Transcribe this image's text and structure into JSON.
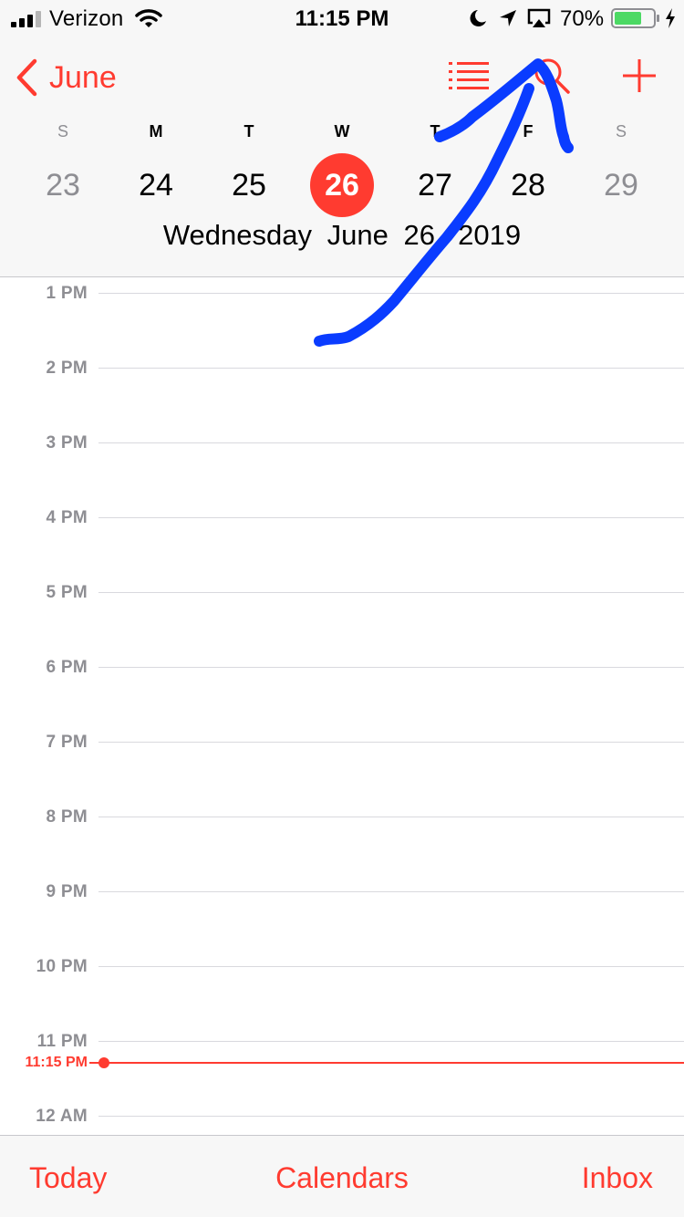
{
  "status_bar": {
    "carrier": "Verizon",
    "time": "11:15 PM",
    "battery_percent": "70%",
    "battery_level": 0.7,
    "icons": [
      "signal-icon",
      "wifi-icon",
      "moon-icon",
      "location-icon",
      "airplay-icon",
      "battery-icon",
      "charging-icon"
    ]
  },
  "nav": {
    "back_label": "June",
    "icons": [
      "chevron-left-icon",
      "list-icon",
      "search-icon",
      "plus-icon"
    ]
  },
  "week": {
    "days": [
      {
        "dow": "S",
        "date": "23"
      },
      {
        "dow": "M",
        "date": "24"
      },
      {
        "dow": "T",
        "date": "25"
      },
      {
        "dow": "W",
        "date": "26"
      },
      {
        "dow": "T",
        "date": "27"
      },
      {
        "dow": "F",
        "date": "28"
      },
      {
        "dow": "S",
        "date": "29"
      }
    ],
    "selected_date": "26"
  },
  "selected_date_text": "Wednesday   June 26, 2019",
  "timeline": {
    "hours": [
      "1 PM",
      "2 PM",
      "3 PM",
      "4 PM",
      "5 PM",
      "6 PM",
      "7 PM",
      "8 PM",
      "9 PM",
      "10 PM",
      "11 PM",
      "12 AM"
    ],
    "current_time_label": "11:15 PM"
  },
  "tabbar": {
    "today": "Today",
    "calendars": "Calendars",
    "inbox": "Inbox"
  },
  "colors": {
    "accent": "#ff3b30",
    "annotation": "#0a3cff",
    "muted": "#8e8e93"
  }
}
